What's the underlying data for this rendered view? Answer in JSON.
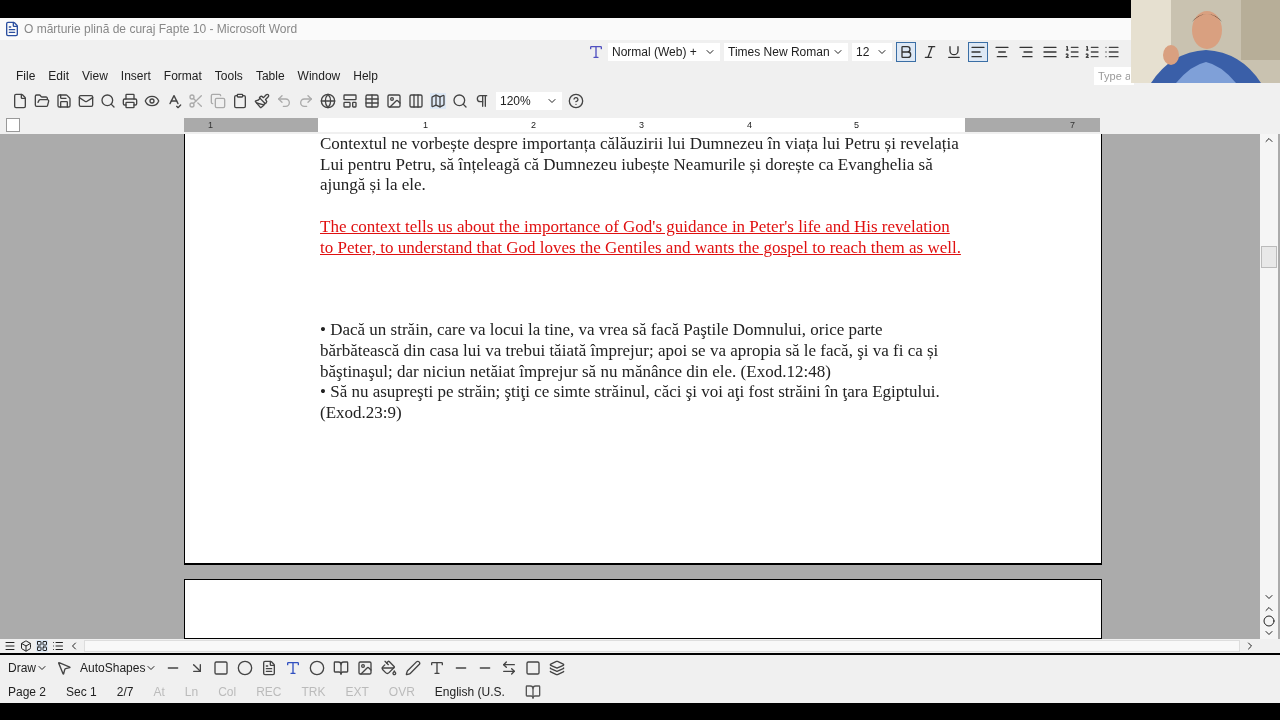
{
  "window": {
    "title": "O mărturie plină de curaj Fapte 10 - Microsoft Word"
  },
  "formatting_toolbar": {
    "style": "Normal (Web) +",
    "font": "Times New Roman",
    "size": "12",
    "buttons": [
      {
        "kind": "bold",
        "selected": true
      },
      {
        "kind": "italic",
        "selected": false
      },
      {
        "kind": "underline",
        "selected": false
      },
      {
        "kind": "align-left",
        "selected": true
      },
      {
        "kind": "align-center",
        "selected": false
      },
      {
        "kind": "align-right",
        "selected": false
      },
      {
        "kind": "justify",
        "selected": false
      }
    ],
    "ask_box": {
      "placeholder": "Type a"
    }
  },
  "menu": [
    "File",
    "Edit",
    "View",
    "Insert",
    "Format",
    "Tools",
    "Table",
    "Window",
    "Help"
  ],
  "standard_toolbar": {
    "zoom": "120%"
  },
  "ruler": {
    "numbers": [
      {
        "label": "1",
        "kind": "margin"
      },
      {
        "label": "1",
        "kind": "text"
      },
      {
        "label": "2",
        "kind": "text"
      },
      {
        "label": "3",
        "kind": "text"
      },
      {
        "label": "4",
        "kind": "text"
      },
      {
        "label": "5",
        "kind": "text"
      },
      {
        "label": "7",
        "kind": "margin"
      }
    ]
  },
  "document": {
    "paragraphs": [
      {
        "kind": "normal",
        "text": "Contextul ne vorbește despre importanța călăuzirii lui Dumnezeu în viața lui Petru și revelația Lui pentru Petru, să înțeleagă că Dumnezeu iubește Neamurile și dorește ca Evanghelia să ajungă și la ele."
      },
      {
        "kind": "translation",
        "text": "The context tells us about the importance of God's guidance in Peter's life and His revelation to Peter, to understand that God loves the Gentiles and wants the gospel to reach them as well."
      },
      {
        "kind": "spacer"
      },
      {
        "kind": "normal",
        "text": "• Dacă un străin, care va locui la tine, va vrea să facă Paştile Domnului, orice parte bărbătească din casa lui va trebui tăiată împrejur; apoi se va apropia să le facă, şi va fi ca și băştinaşul; dar niciun netăiat împrejur să nu mănânce din ele. (Exod.12:48)"
      },
      {
        "kind": "normal",
        "text": "• Să nu asupreşti pe străin; ştiţi ce simte străinul, căci şi voi aţi fost străini în ţara Egiptului. (Exod.23:9)"
      }
    ]
  },
  "drawing_toolbar": {
    "draw": "Draw",
    "autoshapes": "AutoShapes"
  },
  "status_bar": [
    {
      "text": "Page 2",
      "disabled": false
    },
    {
      "text": "Sec 1",
      "disabled": false
    },
    {
      "text": "2/7",
      "disabled": false
    },
    {
      "text": "At",
      "disabled": true
    },
    {
      "text": "Ln",
      "disabled": true
    },
    {
      "text": "Col",
      "disabled": true
    },
    {
      "text": "REC",
      "disabled": true
    },
    {
      "text": "TRK",
      "disabled": true
    },
    {
      "text": "EXT",
      "disabled": true
    },
    {
      "text": "OVR",
      "disabled": true
    },
    {
      "text": "English (U.S.",
      "disabled": false
    }
  ]
}
